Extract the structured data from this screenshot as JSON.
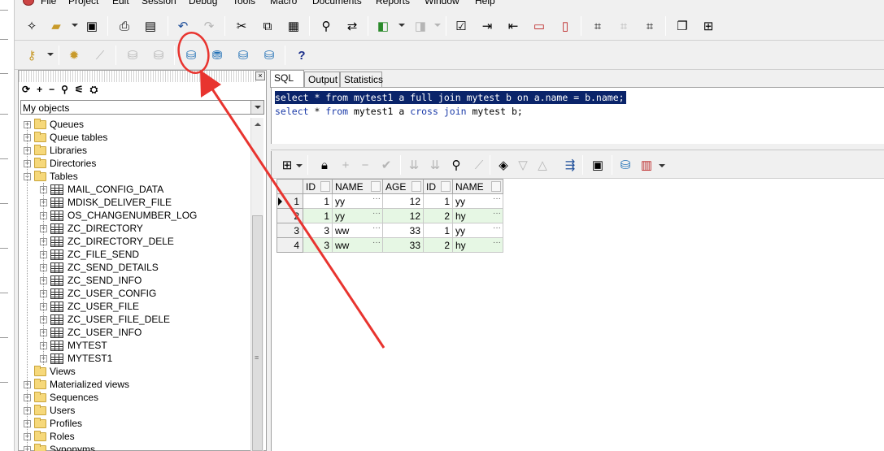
{
  "menu": {
    "items": [
      "File",
      "Project",
      "Edit",
      "Session",
      "Debug",
      "Tools",
      "Macro",
      "Documents",
      "Reports",
      "Window",
      "Help"
    ]
  },
  "toolbar1": {
    "buttons": [
      "new-icon",
      "open-icon",
      "save-icon",
      "print-icon",
      "print-setup-icon",
      "undo-icon",
      "redo-icon",
      "cut-icon",
      "copy-icon",
      "paste-icon",
      "find-icon",
      "replace-icon",
      "import-icon",
      "export-icon",
      "check-icon",
      "indent-icon",
      "unindent-icon",
      "comment-icon",
      "uncomment-icon",
      "explain-icon",
      "window-list-icon",
      "tile-icon"
    ]
  },
  "toolbar2": {
    "buttons": [
      "key-icon",
      "settings-gear-icon",
      "wand-icon",
      "commit-icon",
      "rollback-icon",
      "db-session-icon",
      "sql-db-icon",
      "db-plug-icon",
      "db-refresh-icon",
      "help-icon"
    ],
    "help_label": "?"
  },
  "object_browser": {
    "selector_value": "My objects",
    "tools": [
      "⟳",
      "+",
      "−",
      "⚲",
      "⚟",
      "⛭"
    ],
    "close_label": "×",
    "tree": [
      {
        "label": "Queues",
        "type": "folder",
        "level": 0,
        "expanded": false
      },
      {
        "label": "Queue tables",
        "type": "folder",
        "level": 0,
        "expanded": false
      },
      {
        "label": "Libraries",
        "type": "folder",
        "level": 0,
        "expanded": false
      },
      {
        "label": "Directories",
        "type": "folder",
        "level": 0,
        "expanded": false
      },
      {
        "label": "Tables",
        "type": "folder",
        "level": 0,
        "expanded": true
      },
      {
        "label": "MAIL_CONFIG_DATA",
        "type": "table",
        "level": 1
      },
      {
        "label": "MDISK_DELIVER_FILE",
        "type": "table",
        "level": 1
      },
      {
        "label": "OS_CHANGENUMBER_LOG",
        "type": "table",
        "level": 1
      },
      {
        "label": "ZC_DIRECTORY",
        "type": "table",
        "level": 1
      },
      {
        "label": "ZC_DIRECTORY_DELE",
        "type": "table",
        "level": 1
      },
      {
        "label": "ZC_FILE_SEND",
        "type": "table",
        "level": 1
      },
      {
        "label": "ZC_SEND_DETAILS",
        "type": "table",
        "level": 1
      },
      {
        "label": "ZC_SEND_INFO",
        "type": "table",
        "level": 1
      },
      {
        "label": "ZC_USER_CONFIG",
        "type": "table",
        "level": 1
      },
      {
        "label": "ZC_USER_FILE",
        "type": "table",
        "level": 1
      },
      {
        "label": "ZC_USER_FILE_DELE",
        "type": "table",
        "level": 1
      },
      {
        "label": "ZC_USER_INFO",
        "type": "table",
        "level": 1
      },
      {
        "label": "MYTEST",
        "type": "table",
        "level": 1
      },
      {
        "label": "MYTEST1",
        "type": "table",
        "level": 1
      },
      {
        "label": "Views",
        "type": "folder",
        "level": 0,
        "expanded": false,
        "no_toggle": true
      },
      {
        "label": "Materialized views",
        "type": "folder",
        "level": 0,
        "expanded": false
      },
      {
        "label": "Sequences",
        "type": "folder",
        "level": 0,
        "expanded": false
      },
      {
        "label": "Users",
        "type": "folder",
        "level": 0,
        "expanded": false
      },
      {
        "label": "Profiles",
        "type": "folder",
        "level": 0,
        "expanded": false
      },
      {
        "label": "Roles",
        "type": "folder",
        "level": 0,
        "expanded": false
      },
      {
        "label": "Synonyms",
        "type": "folder",
        "level": 0,
        "expanded": false
      }
    ]
  },
  "tabs": [
    {
      "label": "SQL",
      "active": true
    },
    {
      "label": "Output",
      "active": false
    },
    {
      "label": "Statistics",
      "active": false
    }
  ],
  "editor": {
    "lines": [
      {
        "text": "select * from mytest1 a full join mytest b on a.name = b.name;",
        "selected": true
      },
      {
        "text": "select * from mytest1 a cross join mytest b;",
        "selected": false
      }
    ]
  },
  "result_grid": {
    "columns": [
      "ID",
      "NAME",
      "AGE",
      "ID",
      "NAME"
    ],
    "numeric": [
      true,
      false,
      true,
      true,
      false
    ],
    "rows": [
      [
        "1",
        "yy",
        "12",
        "1",
        "yy"
      ],
      [
        "1",
        "yy",
        "12",
        "2",
        "hy"
      ],
      [
        "3",
        "ww",
        "33",
        "1",
        "yy"
      ],
      [
        "3",
        "ww",
        "33",
        "2",
        "hy"
      ]
    ],
    "current_row": 0,
    "cell_dots": "···"
  },
  "annotation": {
    "color": "#e8342f"
  }
}
